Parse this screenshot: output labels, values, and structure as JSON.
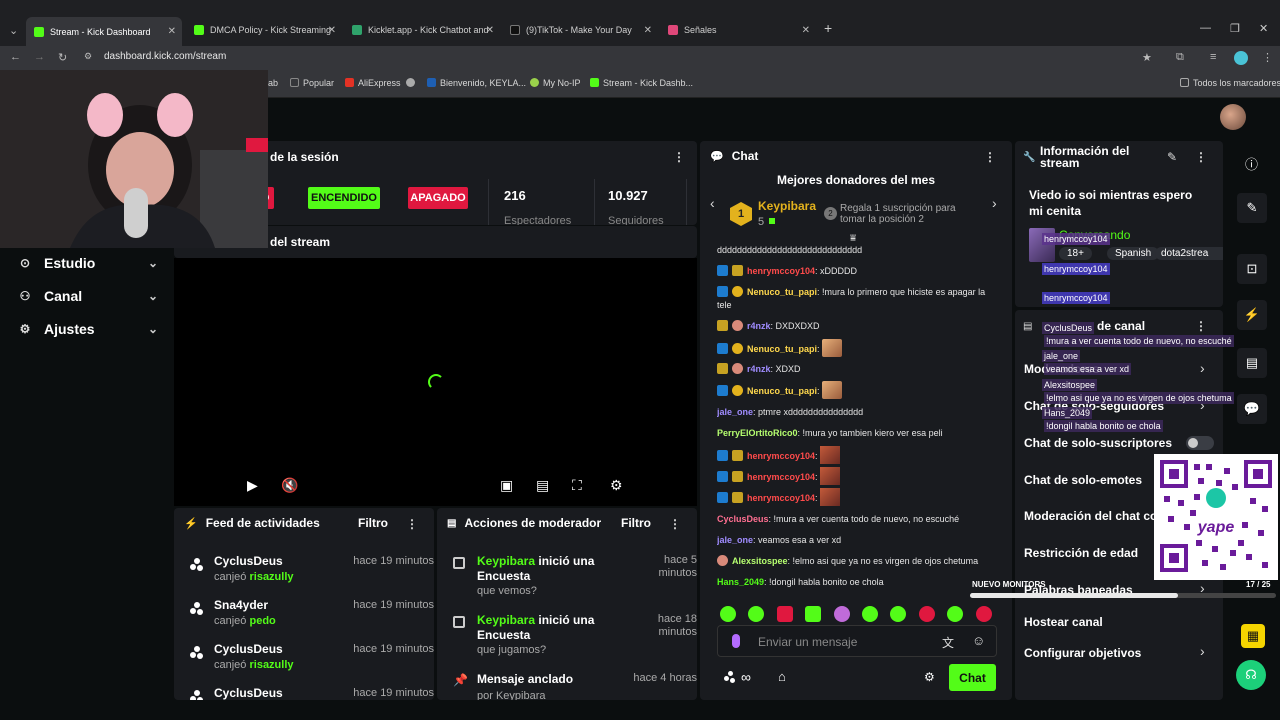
{
  "browser": {
    "tabs": [
      {
        "title": "Stream - Kick Dashboard",
        "color": "#53fc18",
        "active": true
      },
      {
        "title": "DMCA Policy - Kick Streaming",
        "color": "#53fc18",
        "active": false
      },
      {
        "title": "Kicklet.app - Kick Chatbot and",
        "color": "#2fa36b",
        "active": false
      },
      {
        "title": "(9)TikTok - Make Your Day",
        "color": "#111111",
        "active": false
      },
      {
        "title": "Señales",
        "color": "#e0487a",
        "active": false
      }
    ],
    "url": "dashboard.kick.com/stream",
    "bookmarks": [
      {
        "label": "Popular",
        "color": "#888888"
      },
      {
        "label": "AliExpress",
        "color": "#e43225"
      },
      {
        "label": "Bienvenido, KEYLA...",
        "color": "#1e5fb3"
      },
      {
        "label": "My No-IP",
        "color": "#9ad14b"
      },
      {
        "label": "Stream - Kick Dashb...",
        "color": "#53fc18"
      }
    ],
    "all_bookmarks": "Todos los marcadores"
  },
  "sidebar": {
    "items": [
      {
        "label": "Estudio",
        "icon": "map-pin-icon"
      },
      {
        "label": "Canal",
        "icon": "channel-icon"
      },
      {
        "label": "Ajustes",
        "icon": "gear-icon"
      }
    ]
  },
  "session": {
    "title": "de la sesión",
    "btn_partial": "O",
    "on_label": "ENCENDIDO",
    "off_label": "APAGADO",
    "viewers": "216",
    "viewers_label": "Espectadores",
    "followers": "10.927",
    "followers_label": "Seguidores"
  },
  "preview": {
    "title": "del stream"
  },
  "feed": {
    "title": "Feed de actividades",
    "filter": "Filtro",
    "items": [
      {
        "name": "CyclusDeus",
        "time": "hace 19 minutos",
        "action": "canjeó",
        "reward": "risazully"
      },
      {
        "name": "Sna4yder",
        "time": "hace 19 minutos",
        "action": "canjeó",
        "reward": "pedo"
      },
      {
        "name": "CyclusDeus",
        "time": "hace 19 minutos",
        "action": "canjeó",
        "reward": "risazully"
      },
      {
        "name": "CyclusDeus",
        "time": "hace 19 minutos",
        "action": "",
        "reward": ""
      }
    ]
  },
  "modactions": {
    "title": "Acciones de moderador",
    "filter": "Filtro",
    "items": [
      {
        "user": "Keypibara",
        "text": " inició una Encuesta",
        "time": "hace 5 minutos",
        "sub": "que vemos?"
      },
      {
        "user": "Keypibara",
        "text": " inició una Encuesta",
        "time": "hace 18 minutos",
        "sub": "que jugamos?"
      },
      {
        "user": "",
        "text": "Mensaje anclado",
        "time": "hace 4 horas",
        "sub": "por Keypibara"
      }
    ]
  },
  "chat": {
    "title": "Chat",
    "donors_title": "Mejores donadores del mes",
    "top_donor": "Keypibara",
    "top_count": "5",
    "rank": "1",
    "gift_rank": "2",
    "gift_text": "Regala 1 suscripción para tomar la posición 2",
    "messages": [
      {
        "user": "",
        "text": "ddddddddddddddddddddddddddddd"
      },
      {
        "user": "henrymccoy104",
        "text": ": xDDDDD"
      },
      {
        "user": "Nenuco_tu_papi",
        "text": ": !mura lo primero que hiciste es apagar la"
      },
      {
        "user": "",
        "text": "tele"
      },
      {
        "user": "r4nzk",
        "text": ": DXDXDXD"
      },
      {
        "user": "Nenuco_tu_papi",
        "text": ":"
      },
      {
        "user": "r4nzk",
        "text": ": XDXD"
      },
      {
        "user": "Nenuco_tu_papi",
        "text": ":"
      },
      {
        "user": "jale_one",
        "text": ": ptmre xddddddddddddddd"
      },
      {
        "user": "PerryElOrtitoRico0",
        "text": ": !mura yo tambien kiero ver esa peli"
      },
      {
        "user": "henrymccoy104",
        "text": ":"
      },
      {
        "user": "henrymccoy104",
        "text": ":"
      },
      {
        "user": "henrymccoy104",
        "text": ":"
      },
      {
        "user": "CyclusDeus",
        "text": ": !mura a ver cuenta todo de nuevo, no escuché"
      },
      {
        "user": "jale_one",
        "text": ": veamos esa a ver xd"
      },
      {
        "user": "Alexsitospee",
        "text": ": !elmo asi que ya no es virgen de ojos chetuma"
      },
      {
        "user": "Hans_2049",
        "text": ": !dongil habla bonito oe chola"
      }
    ],
    "input_placeholder": "Enviar un mensaje",
    "send_label": "Chat"
  },
  "streaminfo": {
    "title": "Información del stream",
    "stream_title": "Viedo io soi mientras espero mi cenita",
    "category": "Conversando",
    "tags": [
      "18+",
      "Spanish",
      "dota2strea"
    ]
  },
  "channel": {
    "title": "de canal",
    "items": [
      {
        "label": "Moderadores",
        "chevron": true
      },
      {
        "label": "Chat de solo-seguidores",
        "chevron": true
      },
      {
        "label": "Chat de solo-suscriptores",
        "chevron": false
      },
      {
        "label": "Chat de solo-emotes",
        "chevron": false
      },
      {
        "label": "Moderación del chat co",
        "chevron": false
      },
      {
        "label": "Restricción de edad",
        "chevron": false
      },
      {
        "label": "Palabras baneadas",
        "chevron": true
      },
      {
        "label": "Hostear canal",
        "chevron": false
      },
      {
        "label": "Configurar objetivos",
        "chevron": true
      }
    ]
  },
  "overlay": {
    "chat_lines": [
      "henrymccoy104",
      "henrymccoy104",
      "henrymccoy104",
      "CyclusDeus",
      "!mura a ver cuenta todo de nuevo, no escuché",
      "jale_one",
      "veamos esa a ver xd",
      "Alexsitospee",
      "!elmo asi que ya no es virgen de ojos chetuma",
      "Hans_2049",
      "!dongil habla bonito oe chola"
    ],
    "monitor_label": "NUEVO MONITORS",
    "monitor_count": "17 / 25",
    "qr_brand": "yape"
  }
}
